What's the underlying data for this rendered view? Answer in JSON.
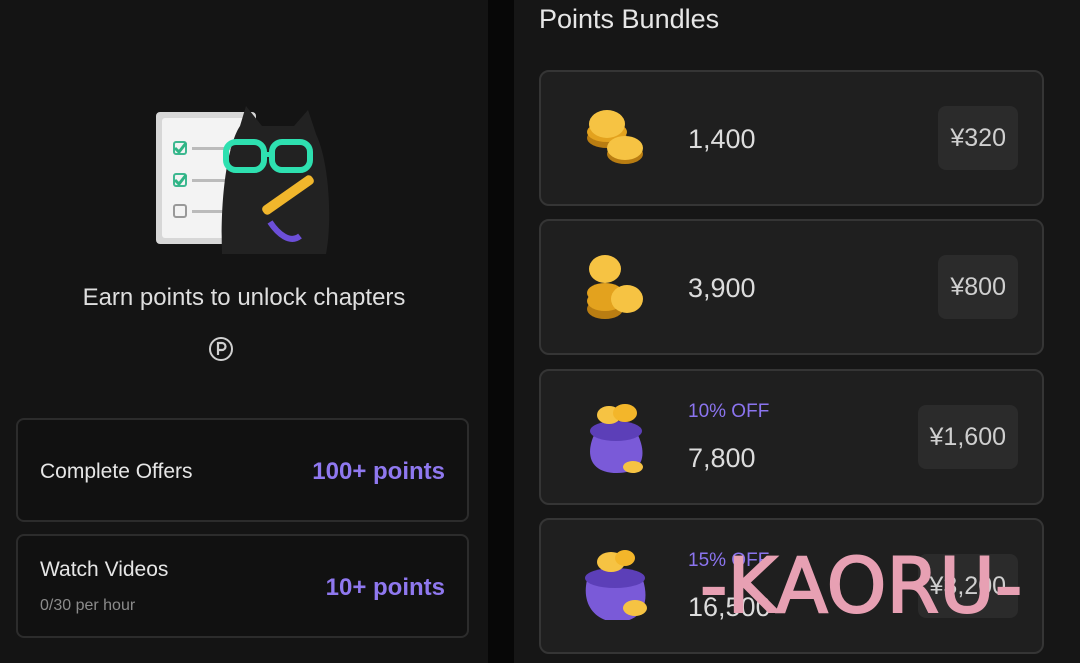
{
  "earn": {
    "title": "Earn points to unlock chapters",
    "points_icon": "points-circle-icon"
  },
  "offers": [
    {
      "title": "Complete Offers",
      "subtitle": "",
      "points": "100+ points"
    },
    {
      "title": "Watch Videos",
      "subtitle": "0/30 per hour",
      "points": "10+ points"
    }
  ],
  "bundles": {
    "section_title": "Points Bundles",
    "items": [
      {
        "discount": "",
        "amount": "1,400",
        "price": "¥320",
        "icon": "coin-stack-small-icon"
      },
      {
        "discount": "",
        "amount": "3,900",
        "price": "¥800",
        "icon": "coin-stack-medium-icon"
      },
      {
        "discount": "10% OFF",
        "amount": "7,800",
        "price": "¥1,600",
        "icon": "coin-bag-icon"
      },
      {
        "discount": "15% OFF",
        "amount": "16,500",
        "price": "¥3,200",
        "icon": "coin-pot-icon"
      }
    ]
  },
  "watermark": "-KAORU-",
  "colors": {
    "accent": "#8f78ef",
    "background": "#141414",
    "card": "#1f1f1f",
    "watermark": "#e7a0b3"
  }
}
